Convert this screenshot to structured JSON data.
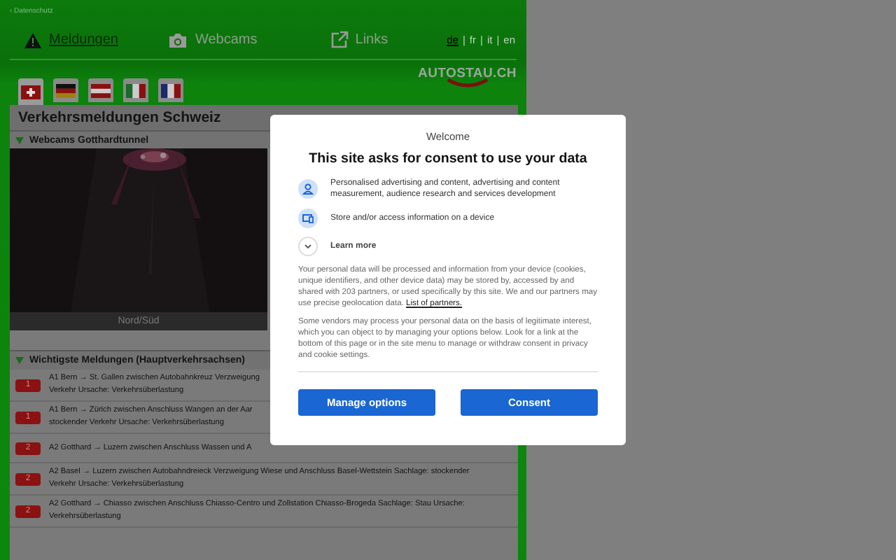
{
  "top_link": "‹ Datenschutz",
  "nav": [
    {
      "label": "Meldungen",
      "selected": true
    },
    {
      "label": "Webcams",
      "selected": false
    },
    {
      "label": "Links",
      "selected": false
    }
  ],
  "language_separators": [
    "|",
    "|",
    "|"
  ],
  "languages": [
    {
      "label": "de",
      "selected": true
    },
    {
      "label": "fr",
      "selected": false
    },
    {
      "label": "it",
      "selected": false
    },
    {
      "label": "en",
      "selected": false
    }
  ],
  "flags": [
    {
      "selected": true
    },
    {
      "selected": false
    },
    {
      "selected": false
    },
    {
      "selected": false
    },
    {
      "selected": false
    }
  ],
  "logo": "AUTOSTAU.CH",
  "title": "Verkehrsmeldungen Schweiz",
  "webcams": {
    "heading": "Webcams Gotthardtunnel",
    "caption": "Nord/Süd"
  },
  "reports": {
    "heading": "Wichtigste Meldungen (Hauptverkehrsachsen)",
    "rows": [
      {
        "badge": "1",
        "lines": [
          "A1 Bern → St. Gallen zwischen Autobahnkreuz Verzweigung",
          "Verkehr Ursache: Verkehrsüberlastung"
        ]
      },
      {
        "badge": "1",
        "lines": [
          "A1 Bern → Zürich zwischen Anschluss Wangen an der Aar",
          "stockender Verkehr Ursache: Verkehrsüberlastung"
        ]
      },
      {
        "badge": "2",
        "lines": [
          "A2 Gotthard → Luzern zwischen Anschluss Wassen und A"
        ]
      },
      {
        "badge": "2",
        "lines": [
          "A2 Basel → Luzern zwischen Autobahndreieck Verzweigung Wiese und Anschluss Basel-Wettstein Sachlage: stockender",
          "Verkehr Ursache: Verkehrsüberlastung"
        ]
      },
      {
        "badge": "2",
        "lines": [
          "A2 Gotthard → Chiasso zwischen Anschluss Chiasso-Centro und Zollstation Chiasso-Brogeda Sachlage: Stau Ursache:",
          "Verkehrsüberlastung"
        ]
      }
    ]
  },
  "dialog": {
    "welcome": "Welcome",
    "title": "This site asks for consent to use your data",
    "purposes": [
      {
        "text": "Personalised advertising and content, advertising and content measurement, audience research and services development"
      },
      {
        "text": "Store and/or access information on a device"
      }
    ],
    "learn_more": "Learn more",
    "paragraph_1": "Your personal data will be processed and information from your device (cookies, unique identifiers, and other device data) may be stored by, accessed by and shared with 203 partners, or used specifically by this site. We and our partners may use precise geolocation data.",
    "partners_link": "List of partners.",
    "paragraph_2": "Some vendors may process your personal data on the basis of legitimate interest, which you can object to by managing your options below. Look for a link at the bottom of this page or in the site menu to manage or withdraw consent in privacy and cookie settings.",
    "buttons": [
      "Manage options",
      "Consent"
    ]
  }
}
